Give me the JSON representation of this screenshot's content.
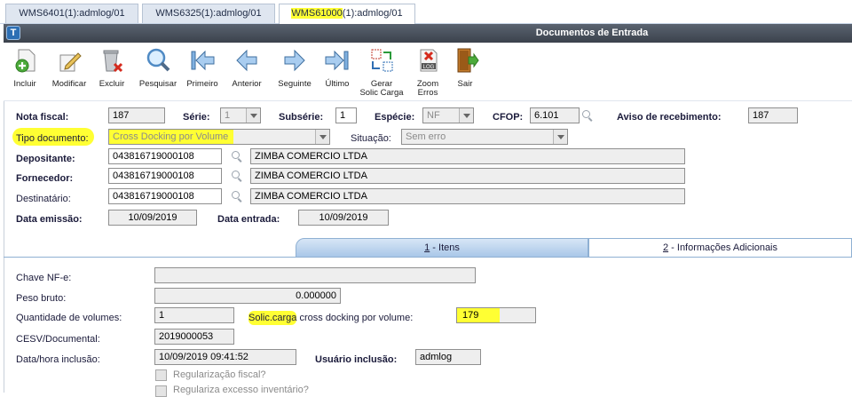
{
  "window_tabs": [
    {
      "label": "WMS6401(1):admlog/01"
    },
    {
      "label": "WMS6325(1):admlog/01"
    },
    {
      "label_prefix": "WMS61000",
      "label_suffix": "(1):admlog/01",
      "active": true
    }
  ],
  "titlebar": {
    "title": "Documentos de Entrada",
    "logo_glyph": "T"
  },
  "toolbar": {
    "incluir": "Incluir",
    "modificar": "Modificar",
    "excluir": "Excluir",
    "pesquisar": "Pesquisar",
    "primeiro": "Primeiro",
    "anterior": "Anterior",
    "seguinte": "Seguinte",
    "ultimo": "Último",
    "gerar_line1": "Gerar",
    "gerar_line2": "Solic Carga",
    "zoom_line1": "Zoom",
    "zoom_line2": "Erros",
    "sair": "Sair",
    "log_text": "LOG"
  },
  "form": {
    "nota_fiscal_label": "Nota fiscal:",
    "nota_fiscal": "187",
    "serie_label": "Série:",
    "serie": "1",
    "subserie_label": "Subsérie:",
    "subserie": "1",
    "especie_label": "Espécie:",
    "especie": "NF",
    "cfop_label": "CFOP:",
    "cfop": "6.101",
    "aviso_label": "Aviso de recebimento:",
    "aviso": "187",
    "tipo_documento_label": "Tipo documento:",
    "tipo_documento": "Cross Docking por Volume",
    "situacao_label": "Situação:",
    "situacao": "Sem erro",
    "depositante_label": "Depositante:",
    "depositante_cnpj": "043816719000108",
    "depositante_nome": "ZIMBA COMERCIO LTDA",
    "fornecedor_label": "Fornecedor:",
    "fornecedor_cnpj": "043816719000108",
    "fornecedor_nome": "ZIMBA COMERCIO LTDA",
    "destinatario_label": "Destinatário:",
    "destinatario_cnpj": "043816719000108",
    "destinatario_nome": "ZIMBA COMERCIO LTDA",
    "data_emissao_label": "Data emissão:",
    "data_emissao": "10/09/2019",
    "data_entrada_label": "Data entrada:",
    "data_entrada": "10/09/2019"
  },
  "tabs": {
    "itens_num": "1",
    "itens_label": " - Itens",
    "info_num": "2",
    "info_label": " - Informações Adicionais"
  },
  "details": {
    "chave_label": "Chave NF-e:",
    "chave": "",
    "peso_label": "Peso bruto:",
    "peso": "0.000000",
    "qtd_volumes_label": "Quantidade de volumes:",
    "qtd_volumes": "1",
    "solic_carga_highlight": "Solic.carga",
    "solic_carga_rest": " cross docking por volume:",
    "solic_carga": "179",
    "cesv_label": "CESV/Documental:",
    "cesv": "2019000053",
    "data_inclusao_label": "Data/hora inclusão:",
    "data_inclusao": "10/09/2019 09:41:52",
    "usuario_label": "Usuário inclusão:",
    "usuario": "admlog",
    "regularizacao_label": "Regularização fiscal?",
    "regulariza_excesso_label": "Regulariza excesso inventário?"
  },
  "colors": {
    "highlight": "#ffff33",
    "titlebar": "#4a525c",
    "tab_active": "#a9c7e8"
  }
}
